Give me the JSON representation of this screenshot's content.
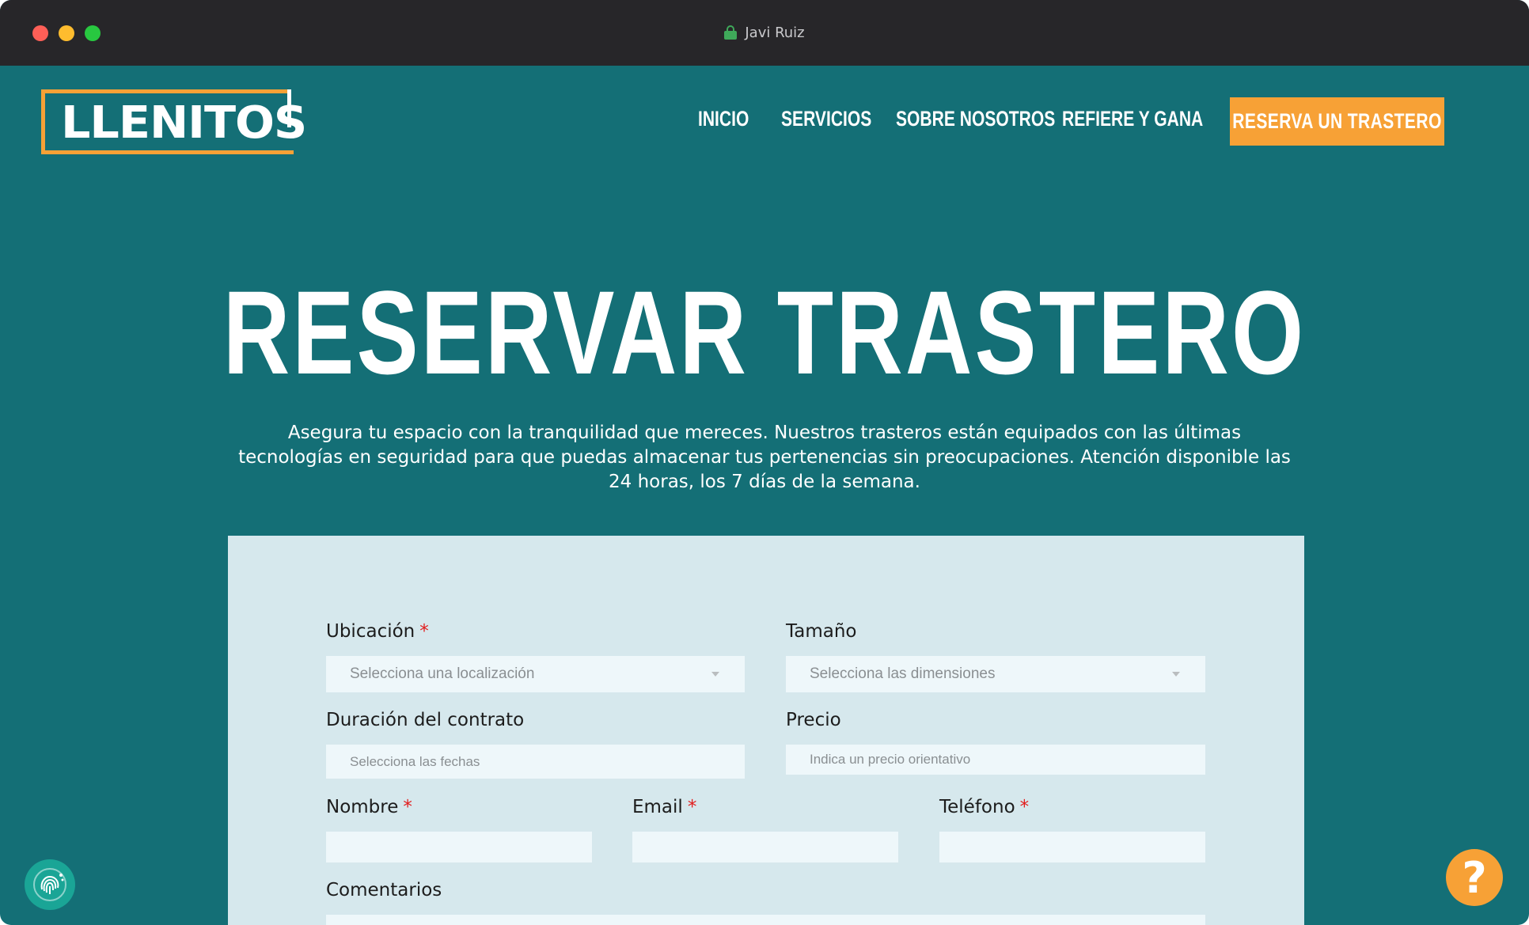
{
  "window": {
    "title": "Javi Ruiz"
  },
  "header": {
    "logo": "LLENITOS",
    "nav": [
      "INICIO",
      "SERVICIOS",
      "SOBRE NOSOTROS",
      "REFIERE Y GANA"
    ],
    "cta": "RESERVA UN TRASTERO"
  },
  "hero": {
    "title": "RESERVAR TRASTERO",
    "subtitle": "Asegura tu espacio con la tranquilidad que mereces. Nuestros trasteros están equipados con las últimas tecnologías en seguridad para que puedas almacenar tus pertenencias sin preocupaciones. Atención disponible las 24 horas, los 7 días de la semana."
  },
  "form": {
    "ubicacion": {
      "label": "Ubicación",
      "required": "*",
      "placeholder": "Selecciona una localización"
    },
    "tamano": {
      "label": "Tamaño",
      "placeholder": "Selecciona las dimensiones"
    },
    "duracion": {
      "label": "Duración del contrato",
      "placeholder": "Selecciona las fechas"
    },
    "precio": {
      "label": "Precio",
      "placeholder": "Indica un precio orientativo"
    },
    "nombre": {
      "label": "Nombre",
      "required": "*",
      "value": ""
    },
    "email": {
      "label": "Email",
      "required": "*",
      "value": ""
    },
    "telefono": {
      "label": "Teléfono",
      "required": "*",
      "value": ""
    },
    "comentarios": {
      "label": "Comentarios"
    }
  },
  "widgets": {
    "help": "?"
  },
  "colors": {
    "brand_teal": "#146f76",
    "accent_orange": "#f7a136",
    "form_bg": "#d6e8ed",
    "required_red": "#e21d1d"
  }
}
